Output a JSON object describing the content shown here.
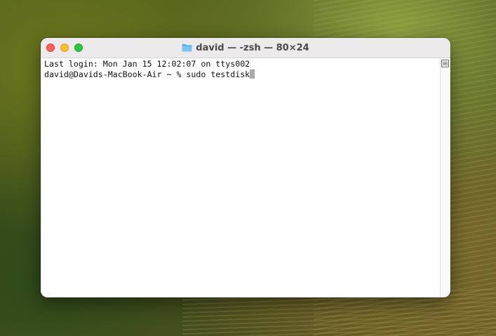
{
  "window": {
    "title": "david — -zsh — 80×24",
    "icon": "folder-icon",
    "accent": "#5bb1ea"
  },
  "terminal": {
    "lines": [
      "Last login: Mon Jan 15 12:02:07 on ttys002",
      "david@Davids-MacBook-Air ~ % sudo testdisk"
    ]
  },
  "colors": {
    "close": "#fe5f57",
    "minimize": "#febc2e",
    "zoom": "#28c840"
  }
}
